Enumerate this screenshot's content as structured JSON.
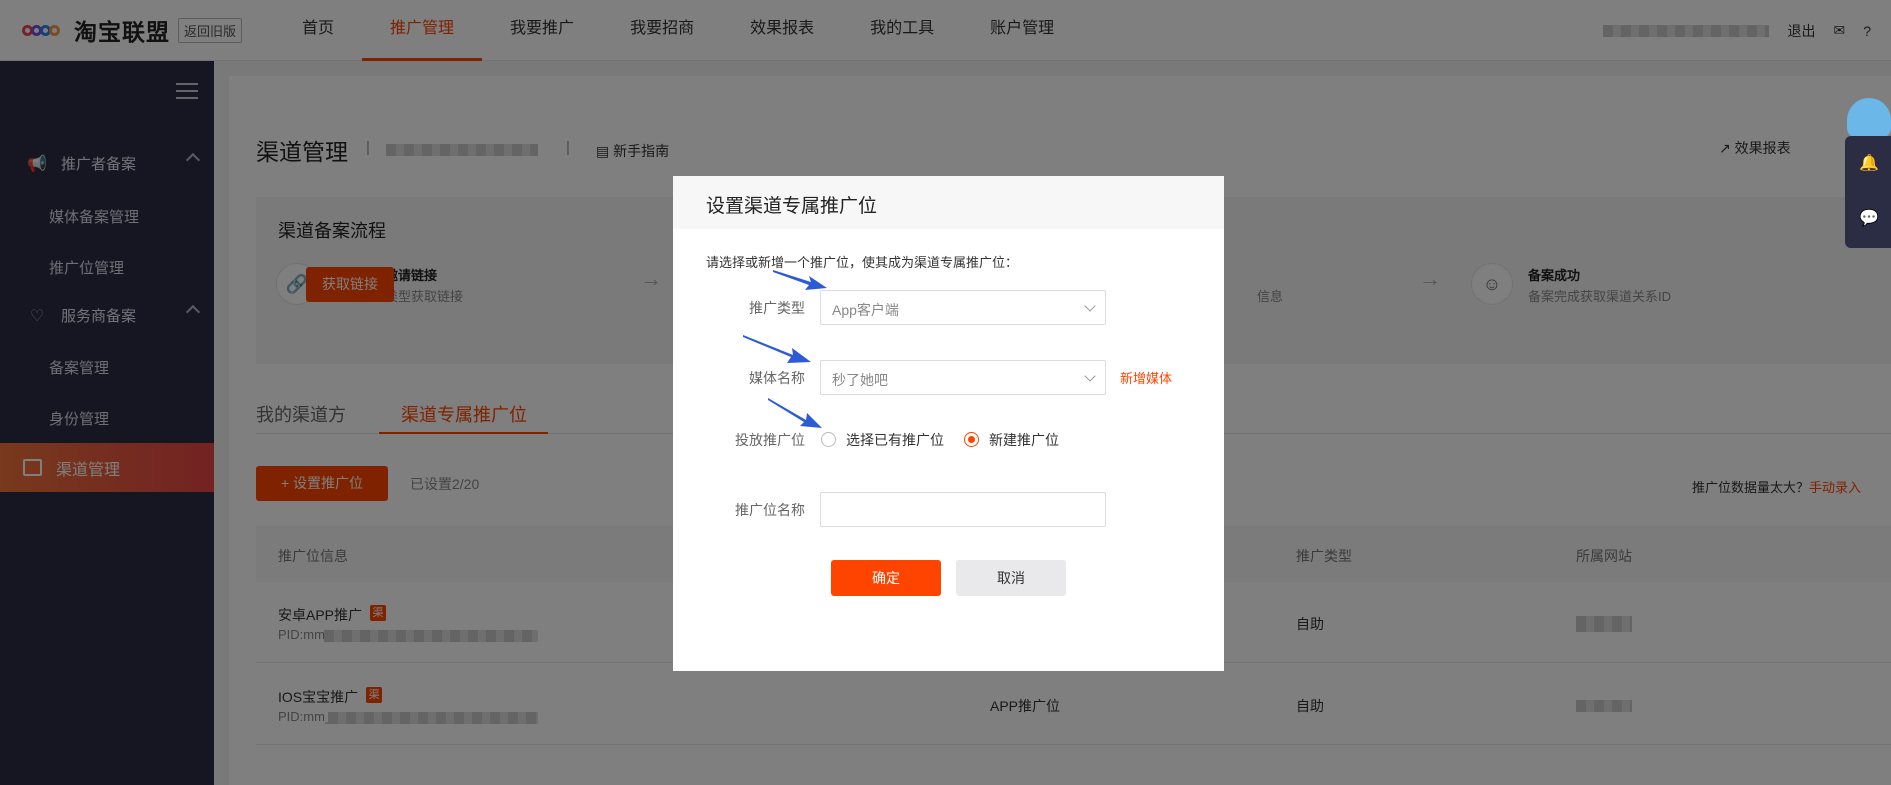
{
  "topnav": {
    "brand": "淘宝联盟",
    "old_version": "返回旧版",
    "items": [
      "首页",
      "推广管理",
      "我要推广",
      "我要招商",
      "效果报表",
      "我的工具",
      "账户管理"
    ],
    "logout": "退出"
  },
  "sidebar": {
    "group1": "推广者备案",
    "group1_items": [
      "媒体备案管理",
      "推广位管理"
    ],
    "group2": "服务商备案",
    "group2_items": [
      "备案管理",
      "身份管理"
    ],
    "active": "渠道管理"
  },
  "page": {
    "title": "渠道管理",
    "guide": "新手指南",
    "report": "效果报表",
    "flow_title": "渠道备案流程",
    "step1_title": "获取备案邀请链接",
    "step1_sub": "选择渠道类型获取链接",
    "step1_btn": "获取链接",
    "step_mid_fragment": "信息",
    "step3_title": "备案成功",
    "step3_sub": "备案完成获取渠道关系ID",
    "tabs": [
      "我的渠道方",
      "渠道专属推广位"
    ],
    "add_btn": "+ 设置推广位",
    "set_count": "已设置2/20",
    "hint": "推广位数据量太大？",
    "hint_link": "手动录入",
    "table_headers": [
      "推广位信息",
      "推广类型",
      "所属网站"
    ],
    "rows": [
      {
        "name": "安卓APP推广",
        "badge": "渠",
        "pid": "PID:mm",
        "type": "",
        "mode": "自助"
      },
      {
        "name": "IOS宝宝推广",
        "badge": "渠",
        "pid": "PID:mm_",
        "type": "APP推广位",
        "mode": "自助"
      }
    ]
  },
  "modal": {
    "title": "设置渠道专属推广位",
    "desc": "请选择或新增一个推广位，使其成为渠道专属推广位：",
    "label_type": "推广类型",
    "type_value": "App客户端",
    "label_media": "媒体名称",
    "media_value": "秒了她吧",
    "add_media": "新增媒体",
    "label_position": "投放推广位",
    "radio_existing": "选择已有推广位",
    "radio_new": "新建推广位",
    "label_name": "推广位名称",
    "name_value": "",
    "ok": "确定",
    "cancel": "取消"
  },
  "colors": {
    "accent": "#ff4400",
    "sidebar_bg": "#2b2d45",
    "annotation_arrow": "#2d5bd8"
  }
}
